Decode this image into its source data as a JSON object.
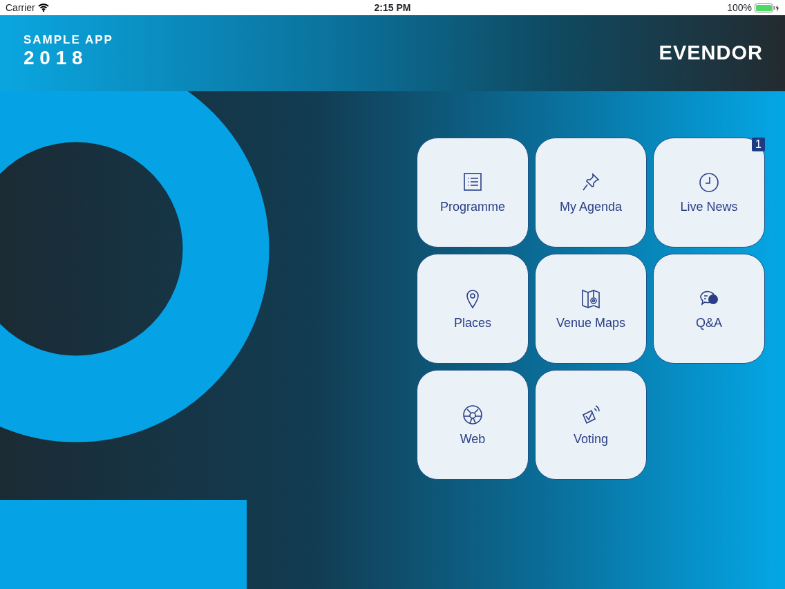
{
  "status_bar": {
    "carrier": "Carrier",
    "time": "2:15 PM",
    "battery": "100%"
  },
  "header": {
    "app_name": "SAMPLE APP",
    "year": "2 0 1 8",
    "logo": "EVENDOR"
  },
  "tiles": [
    {
      "label": "Programme",
      "kind": "list"
    },
    {
      "label": "My Agenda",
      "kind": "pin"
    },
    {
      "label": "Live News",
      "kind": "clock",
      "badge": "1"
    },
    {
      "label": "Places",
      "kind": "location"
    },
    {
      "label": "Venue Maps",
      "kind": "map"
    },
    {
      "label": "Q&A",
      "kind": "chat"
    },
    {
      "label": "Web",
      "kind": "globe"
    },
    {
      "label": "Voting",
      "kind": "voting"
    }
  ]
}
